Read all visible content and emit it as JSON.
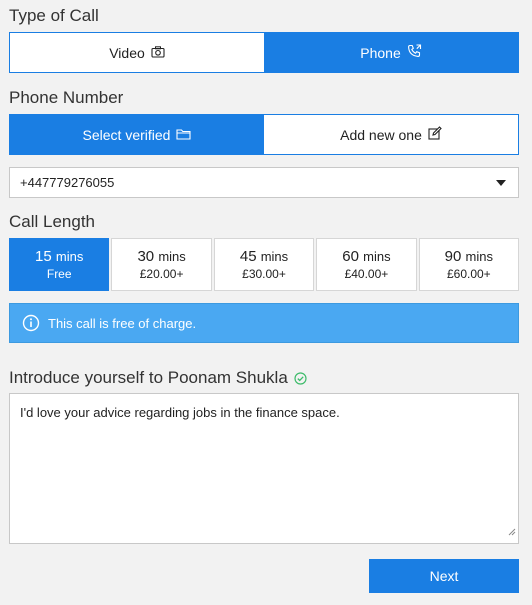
{
  "call_type": {
    "title": "Type of Call",
    "options": [
      {
        "label": "Video",
        "icon": "camera-icon",
        "selected": false
      },
      {
        "label": "Phone",
        "icon": "phone-icon",
        "selected": true
      }
    ]
  },
  "phone_number": {
    "title": "Phone Number",
    "options": [
      {
        "label": "Select verified",
        "icon": "folder-icon",
        "selected": true
      },
      {
        "label": "Add new one",
        "icon": "edit-icon",
        "selected": false
      }
    ],
    "selected_value": "+447779276055"
  },
  "call_length": {
    "title": "Call Length",
    "options": [
      {
        "minutes": "15",
        "unit": "mins",
        "price": "Free",
        "selected": true
      },
      {
        "minutes": "30",
        "unit": "mins",
        "price": "£20.00+",
        "selected": false
      },
      {
        "minutes": "45",
        "unit": "mins",
        "price": "£30.00+",
        "selected": false
      },
      {
        "minutes": "60",
        "unit": "mins",
        "price": "£40.00+",
        "selected": false
      },
      {
        "minutes": "90",
        "unit": "mins",
        "price": "£60.00+",
        "selected": false
      }
    ]
  },
  "notice": {
    "icon": "info-icon",
    "text": "This call is free of charge."
  },
  "intro": {
    "title": "Introduce yourself to Poonam Shukla",
    "verified_icon": "check-circle-icon",
    "message": "I'd love your advice regarding jobs in the finance space."
  },
  "actions": {
    "next_label": "Next"
  },
  "colors": {
    "accent": "#1a7ee3",
    "notice_bg": "#4aa8f2",
    "verified": "#3dbb6a"
  }
}
